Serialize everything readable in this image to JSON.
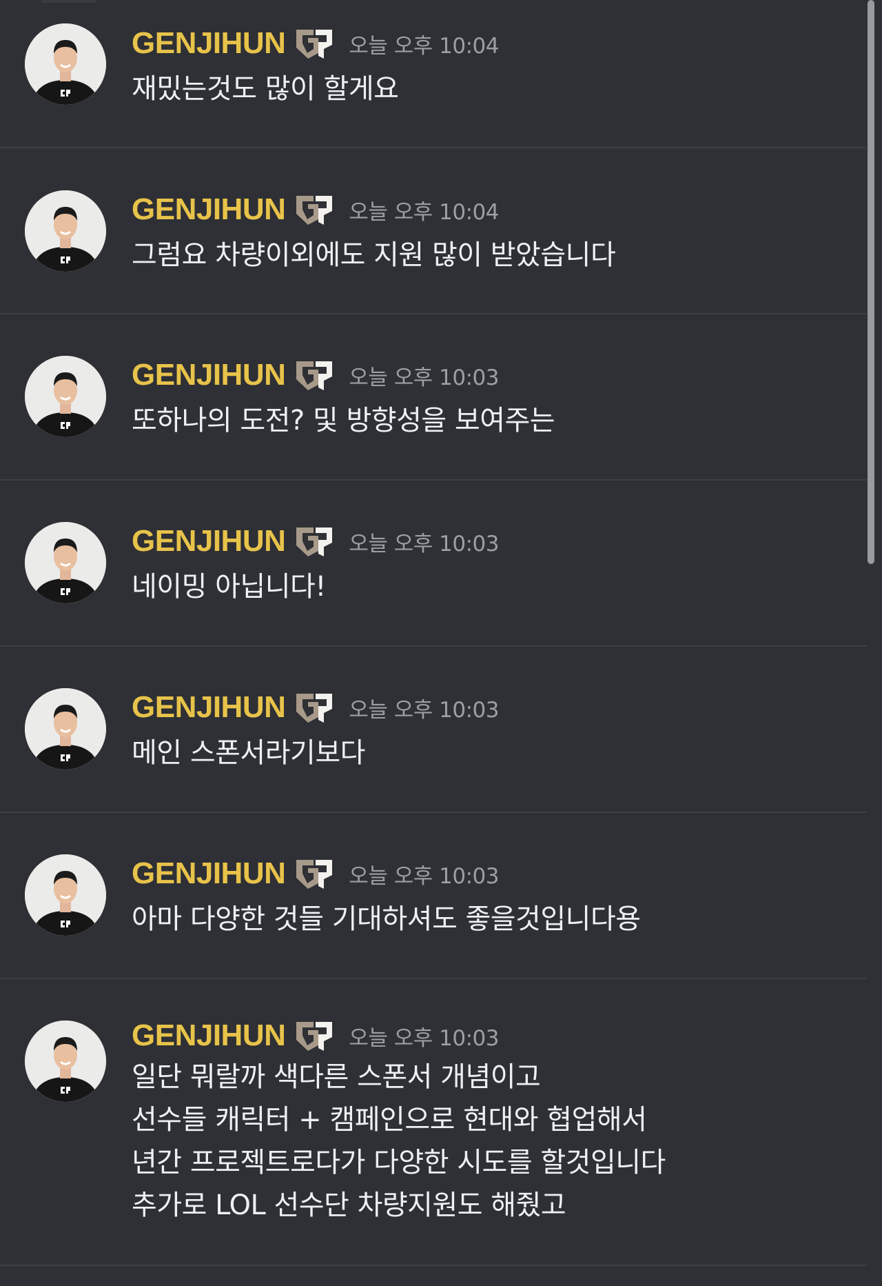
{
  "colors": {
    "background": "#2f3035",
    "username": "#e8c34a",
    "timestamp": "#9c9fa6",
    "text": "#eef0f3",
    "divider": "#3d3f45"
  },
  "messages": [
    {
      "username": "GENJIHUN",
      "badge_icon": "gen-g-logo-icon",
      "timestamp": "오늘 오후 10:04",
      "lines": [
        "재밌는것도 많이 할게요"
      ]
    },
    {
      "username": "GENJIHUN",
      "badge_icon": "gen-g-logo-icon",
      "timestamp": "오늘 오후 10:04",
      "lines": [
        "그럼요 차량이외에도 지원 많이 받았습니다"
      ]
    },
    {
      "username": "GENJIHUN",
      "badge_icon": "gen-g-logo-icon",
      "timestamp": "오늘 오후 10:03",
      "lines": [
        "또하나의 도전? 및 방향성을 보여주는"
      ]
    },
    {
      "username": "GENJIHUN",
      "badge_icon": "gen-g-logo-icon",
      "timestamp": "오늘 오후 10:03",
      "lines": [
        "네이밍 아닙니다!"
      ]
    },
    {
      "username": "GENJIHUN",
      "badge_icon": "gen-g-logo-icon",
      "timestamp": "오늘 오후 10:03",
      "lines": [
        "메인 스폰서라기보다"
      ]
    },
    {
      "username": "GENJIHUN",
      "badge_icon": "gen-g-logo-icon",
      "timestamp": "오늘 오후 10:03",
      "lines": [
        "아마 다양한 것들 기대하셔도 좋을것입니다용"
      ]
    },
    {
      "username": "GENJIHUN",
      "badge_icon": "gen-g-logo-icon",
      "timestamp": "오늘 오후 10:03",
      "lines": [
        "일단 뭐랄까 색다른 스폰서 개념이고",
        "선수들 캐릭터 + 캠페인으로 현대와 협업해서",
        "년간 프로젝트로다가 다양한 시도를 할것입니다",
        "추가로 LOL 선수단 차량지원도 해줬고"
      ]
    }
  ]
}
